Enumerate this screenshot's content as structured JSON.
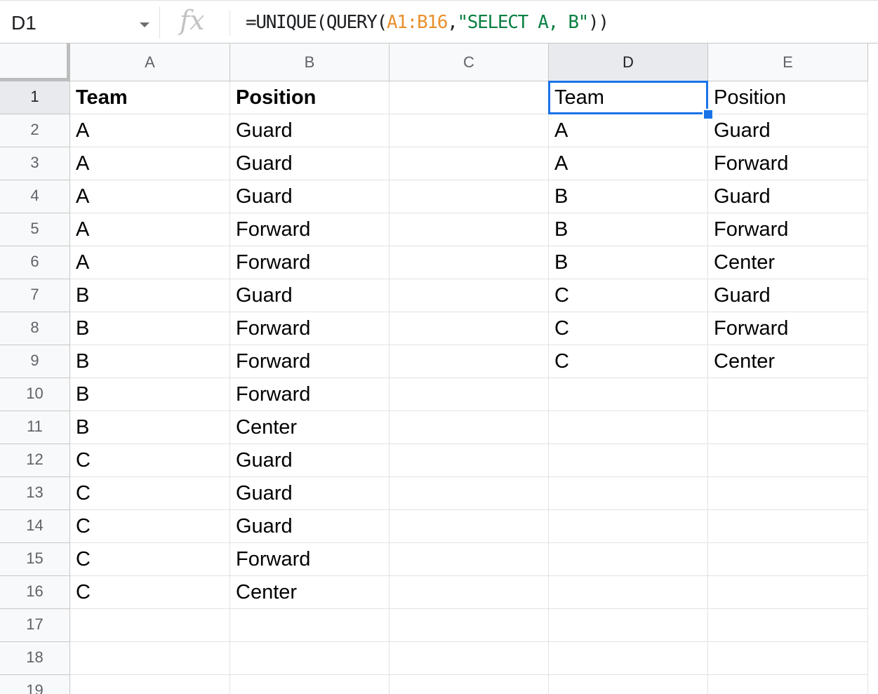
{
  "formula_bar": {
    "name_box": "D1",
    "fx_symbol": "fx",
    "formula_parts": [
      "=UNIQUE(QUERY(",
      "A1:B16",
      ",",
      "\"SELECT A, B\"",
      "))"
    ]
  },
  "columns": [
    "A",
    "B",
    "C",
    "D",
    "E"
  ],
  "rows": [
    "1",
    "2",
    "3",
    "4",
    "5",
    "6",
    "7",
    "8",
    "9",
    "10",
    "11",
    "12",
    "13",
    "14",
    "15",
    "16",
    "17",
    "18",
    "19"
  ],
  "cells": [
    [
      "Team",
      "Position",
      "",
      "Team",
      "Position"
    ],
    [
      "A",
      "Guard",
      "",
      "A",
      "Guard"
    ],
    [
      "A",
      "Guard",
      "",
      "A",
      "Forward"
    ],
    [
      "A",
      "Guard",
      "",
      "B",
      "Guard"
    ],
    [
      "A",
      "Forward",
      "",
      "B",
      "Forward"
    ],
    [
      "A",
      "Forward",
      "",
      "B",
      "Center"
    ],
    [
      "B",
      "Guard",
      "",
      "C",
      "Guard"
    ],
    [
      "B",
      "Forward",
      "",
      "C",
      "Forward"
    ],
    [
      "B",
      "Forward",
      "",
      "C",
      "Center"
    ],
    [
      "B",
      "Forward",
      "",
      "",
      ""
    ],
    [
      "B",
      "Center",
      "",
      "",
      ""
    ],
    [
      "C",
      "Guard",
      "",
      "",
      ""
    ],
    [
      "C",
      "Guard",
      "",
      "",
      ""
    ],
    [
      "C",
      "Guard",
      "",
      "",
      ""
    ],
    [
      "C",
      "Forward",
      "",
      "",
      ""
    ],
    [
      "C",
      "Center",
      "",
      "",
      ""
    ],
    [
      "",
      "",
      "",
      "",
      ""
    ],
    [
      "",
      "",
      "",
      "",
      ""
    ],
    [
      "",
      "",
      "",
      "",
      ""
    ]
  ],
  "bold_cells": [
    "A1",
    "B1"
  ],
  "selected_cell": "D1",
  "colors": {
    "selection": "#1a73e8",
    "range_reference": "#e8912d",
    "string_literal": "#0b8043"
  }
}
